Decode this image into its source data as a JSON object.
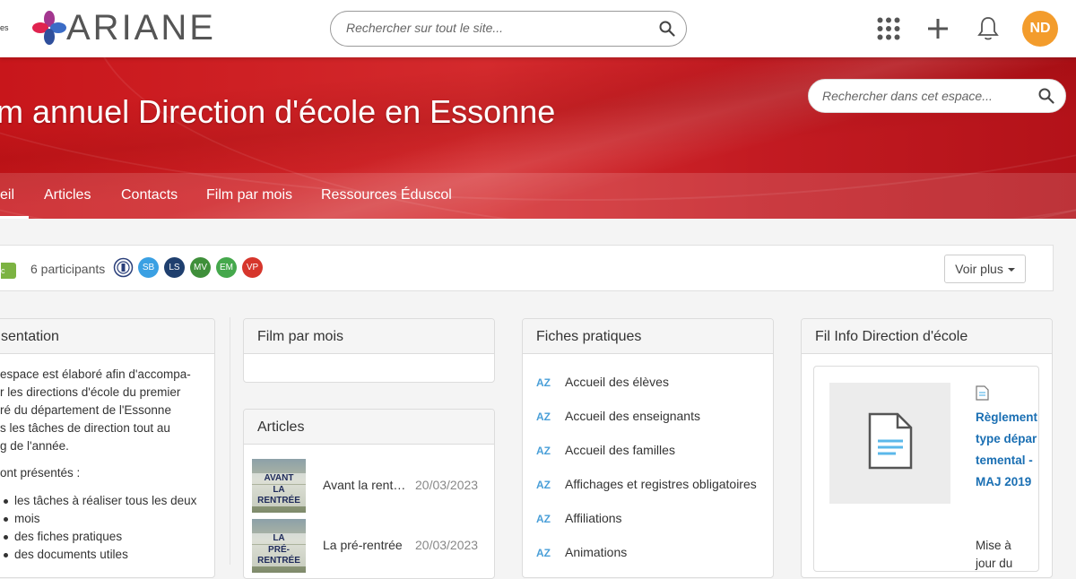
{
  "topbar": {
    "brand_cut": "es",
    "logo_text": "ARIANE",
    "search_placeholder": "Rechercher sur tout le site...",
    "user_initials": "ND",
    "user_color": "#f39c2c"
  },
  "banner": {
    "title": "m annuel Direction d'école en Essonne",
    "search_placeholder": "Rechercher dans cet espace..."
  },
  "nav": {
    "items": [
      {
        "label": "eil"
      },
      {
        "label": "Articles"
      },
      {
        "label": "Contacts"
      },
      {
        "label": "Film par mois"
      },
      {
        "label": "Ressources Éduscol"
      }
    ]
  },
  "members": {
    "public_badge": "lic",
    "participants_label": "6 participants",
    "avatars": [
      {
        "initials": "",
        "color": "#ffffff",
        "icon": "institution-logo-icon"
      },
      {
        "initials": "SB",
        "color": "#3aa0e3"
      },
      {
        "initials": "LS",
        "color": "#1f3f6e"
      },
      {
        "initials": "MV",
        "color": "#3f8f3a"
      },
      {
        "initials": "EM",
        "color": "#45a84c"
      },
      {
        "initials": "VP",
        "color": "#d6362c"
      }
    ],
    "voir_plus": "Voir plus"
  },
  "panels": {
    "presentation": {
      "title": "sentation",
      "lines": [
        "espace est élaboré afin d'accompa-",
        "r les directions d'école du premier",
        "ré du département de l'Essonne",
        "s les tâches de direction tout au",
        "g de l'année.",
        "ont présentés :"
      ],
      "list": [
        "les tâches à réaliser tous les deux",
        "mois",
        "des fiches pratiques",
        "des documents utiles"
      ]
    },
    "film": {
      "title": "Film par mois"
    },
    "articles": {
      "title": "Articles",
      "items": [
        {
          "thumb_label_1": "AVANT",
          "thumb_label_2": "LA RENTRÉE",
          "title": "Avant la rent…",
          "date": "20/03/2023"
        },
        {
          "thumb_label_1": "LA",
          "thumb_label_2": "PRÉ-RENTRÉE",
          "title": "La pré-rentrée",
          "date": "20/03/2023"
        }
      ]
    },
    "fiches": {
      "title": "Fiches pratiques",
      "az": "AZ",
      "items": [
        "Accueil des élèves",
        "Accueil des enseignants",
        "Accueil des familles",
        "Affichages et registres obligatoires",
        "Affiliations",
        "Animations"
      ]
    },
    "fil_info": {
      "title": "Fil Info Direction d'école",
      "doc_title": "Règlement type départemental - MAJ 2019",
      "doc_desc": "Mise à jour du"
    }
  }
}
